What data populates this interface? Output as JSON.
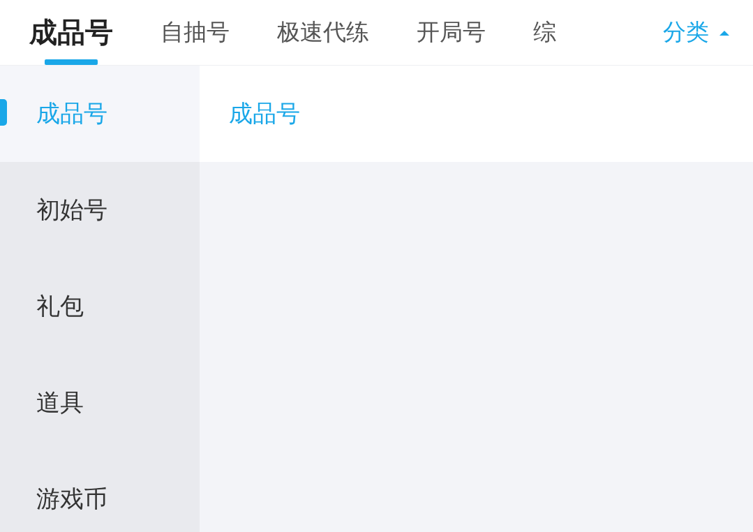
{
  "tabs": [
    {
      "label": "成品号",
      "selected": true
    },
    {
      "label": "自抽号",
      "selected": false
    },
    {
      "label": "极速代练",
      "selected": false
    },
    {
      "label": "开局号",
      "selected": false
    },
    {
      "label": "综",
      "selected": false
    }
  ],
  "category_button": {
    "label": "分类",
    "expanded": true
  },
  "sidebar": {
    "items": [
      {
        "label": "成品号",
        "selected": true
      },
      {
        "label": "初始号",
        "selected": false
      },
      {
        "label": "礼包",
        "selected": false
      },
      {
        "label": "道具",
        "selected": false
      },
      {
        "label": "游戏币",
        "selected": false
      }
    ]
  },
  "content": {
    "heading": "成品号"
  }
}
